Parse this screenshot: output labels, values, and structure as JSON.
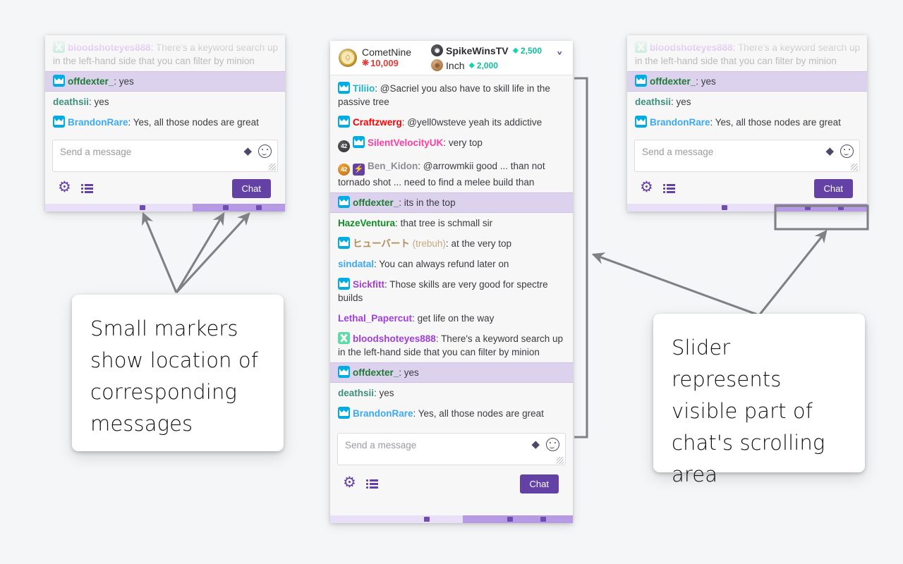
{
  "header": {
    "streamer": {
      "name": "CometNine",
      "streak_icon": "sparkle-star",
      "streak_count": "10,009"
    },
    "leaders": [
      {
        "name": "SpikeWinsTV",
        "amount": "2,500",
        "gem_icon": "gem-icon",
        "badge": "sub-badge-dark"
      },
      {
        "name": "Inch",
        "amount": "2,000",
        "gem_icon": "gem-icon",
        "badge": "sub-badge-bronze"
      }
    ],
    "expand_icon": "chevron-down-icon"
  },
  "messages": [
    {
      "badges": [
        "mod-badge"
      ],
      "nick": "Tiliio",
      "nick_color": "#1fb6c9",
      "text": "@Sacriel you also have to skill life in the passive tree",
      "highlight": false
    },
    {
      "badges": [
        "mod-badge"
      ],
      "nick": "Craftzwerg",
      "nick_color": "#ff0000",
      "text": "@yell0wsteve yeah its addictive",
      "highlight": false
    },
    {
      "badges": [
        "sub-badge-dark-42",
        "mod-badge"
      ],
      "nick": "SilentVelocityUK",
      "nick_color": "#ff3ea0",
      "text": "very top",
      "highlight": false
    },
    {
      "badges": [
        "sub-badge-orange-42",
        "prime-badge"
      ],
      "nick": "Ben_Kidon",
      "nick_color": "#8c8c93",
      "text": "@arrowmkii good ... than not tornado shot ... need to find a melee build than",
      "highlight": false
    },
    {
      "badges": [
        "mod-badge"
      ],
      "nick": "offdexter_",
      "nick_color": "#1d7a33",
      "text": "its in the top",
      "highlight": true
    },
    {
      "badges": [],
      "nick": "HazeVentura",
      "nick_color": "#0e8c22",
      "text": "that tree is schmall sir",
      "highlight": false
    },
    {
      "badges": [
        "mod-badge"
      ],
      "nick": "ヒューバート",
      "alias": "(trebuh)",
      "nick_color": "#b08d5a",
      "text": "at the very top",
      "highlight": false
    },
    {
      "badges": [],
      "nick": "sindatal",
      "nick_color": "#3ba9f5",
      "text": "You can always refund later on",
      "highlight": false
    },
    {
      "badges": [
        "mod-badge"
      ],
      "nick": "Sickfitt",
      "nick_color": "#a33dd6",
      "text": "Those skills are very good for spectre builds",
      "highlight": false
    },
    {
      "badges": [],
      "nick": "Lethal_Papercut",
      "nick_color": "#a03de0",
      "text": "get life on the way",
      "highlight": false
    },
    {
      "badges": [
        "misc-badge"
      ],
      "nick": "bloodshoteyes888",
      "nick_color": "#a03de0",
      "text": "There's a keyword search up in the left-hand side that you can filter by minion",
      "highlight": false
    },
    {
      "badges": [
        "mod-badge"
      ],
      "nick": "offdexter_",
      "nick_color": "#1d7a33",
      "text": "yes",
      "highlight": true
    },
    {
      "badges": [],
      "nick": "deathsii",
      "nick_color": "#3f8f7e",
      "text": "yes",
      "highlight": false
    },
    {
      "badges": [
        "mod-badge"
      ],
      "nick": "BrandonRare",
      "nick_color": "#3ba9f5",
      "text": "Yes, all those nodes are great",
      "highlight": false
    }
  ],
  "side_messages": [
    {
      "badges": [
        "misc-badge"
      ],
      "nick": "bloodshoteyes888",
      "nick_color": "#a03de0",
      "text": "There's a keyword search up in the left-hand side that you can filter by minion",
      "highlight": false
    },
    {
      "badges": [
        "mod-badge"
      ],
      "nick": "offdexter_",
      "nick_color": "#1d7a33",
      "text": "yes",
      "highlight": true
    },
    {
      "badges": [],
      "nick": "deathsii",
      "nick_color": "#3f8f7e",
      "text": "yes",
      "highlight": false
    },
    {
      "badges": [
        "mod-badge"
      ],
      "nick": "BrandonRare",
      "nick_color": "#3ba9f5",
      "text": "Yes, all those nodes are great",
      "highlight": false
    }
  ],
  "composer": {
    "placeholder": "Send a message",
    "bits_icon": "bits-icon",
    "emote_icon": "emote-smiley-icon",
    "resize_icon": "resize-grip-icon",
    "settings_icon": "gear-icon",
    "user_list_icon": "user-list-icon",
    "send_label": "Chat"
  },
  "slider": {
    "thumb_label": "scroll-thumb",
    "marker_label": "message-marker",
    "track_color": "#eadff9",
    "thumb_color": "#b69ae3",
    "marker_color": "#6f4cb0"
  },
  "callouts": [
    {
      "id": "markers-callout",
      "text": "Small markers show location of corresponding messages"
    },
    {
      "id": "slider-callout",
      "text": "Slider represents visible part of chat's scrolling area"
    }
  ],
  "colors": {
    "accent": "#6441a5",
    "highlight_row": "#ddd2ee",
    "panel_bg": "#f7f7f8",
    "page_bg": "#f4f6f8",
    "annotation": "#808085"
  }
}
